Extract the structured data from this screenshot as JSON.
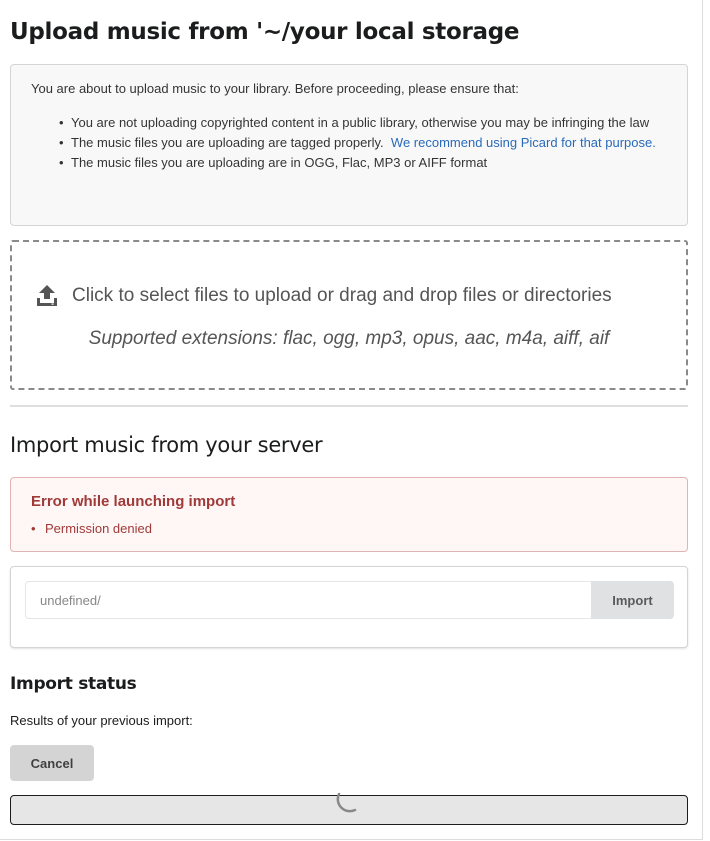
{
  "upload": {
    "title": "Upload music from '~/your local storage",
    "notice_intro": "You are about to upload music to your library. Before proceeding, please ensure that:",
    "bullets": {
      "b1": "You are not uploading copyrighted content in a public library, otherwise you may be infringing the law",
      "b2_text": "The music files you are uploading are tagged properly.",
      "b2_link": "We recommend using Picard for that purpose.",
      "b3": "The music files you are uploading are in OGG, Flac, MP3 or AIFF format"
    },
    "dropzone_text": "Click to select files to upload or drag and drop files or directories",
    "dropzone_extensions": "Supported extensions: flac, ogg, mp3, opus, aac, m4a, aiff, aif",
    "icon": "upload-icon"
  },
  "server_import": {
    "title": "Import music from your server",
    "error": {
      "heading": "Error while launching import",
      "items": [
        "Permission denied"
      ]
    },
    "path_value": "undefined/",
    "import_label": "Import"
  },
  "status": {
    "title": "Import status",
    "results_text": "Results of your previous import:",
    "cancel_label": "Cancel"
  },
  "colors": {
    "link": "#2a6ab8",
    "error_text": "#9f3a38",
    "error_bg": "#fff6f6",
    "notice_bg": "#f8f8f9"
  }
}
